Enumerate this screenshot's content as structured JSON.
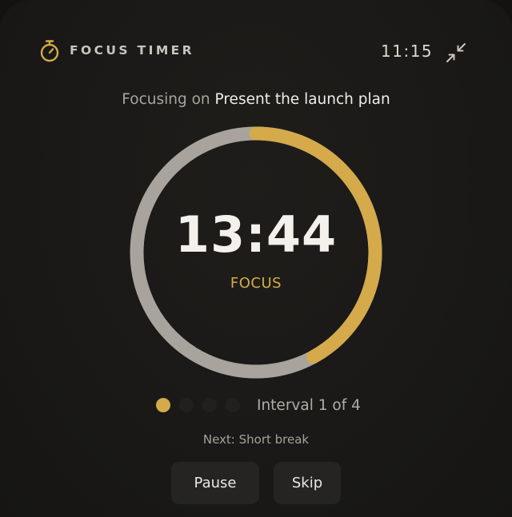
{
  "header": {
    "title": "FOCUS TIMER",
    "clock": "11:15",
    "timer_icon": "stopwatch-icon",
    "collapse_icon": "collapse-arrows-icon"
  },
  "task": {
    "prefix": "Focusing on",
    "name": "Present the launch plan"
  },
  "timer": {
    "remaining": "13:44",
    "mode": "FOCUS",
    "progress_fraction": 0.42
  },
  "intervals": {
    "current": 1,
    "total": 4,
    "label": "Interval 1 of 4"
  },
  "next": {
    "label": "Next: Short break"
  },
  "controls": {
    "pause_label": "Pause",
    "skip_label": "Skip"
  },
  "colors": {
    "accent": "#d4aa4a",
    "ring_track": "#a8a49d",
    "background": "#1a1917"
  }
}
